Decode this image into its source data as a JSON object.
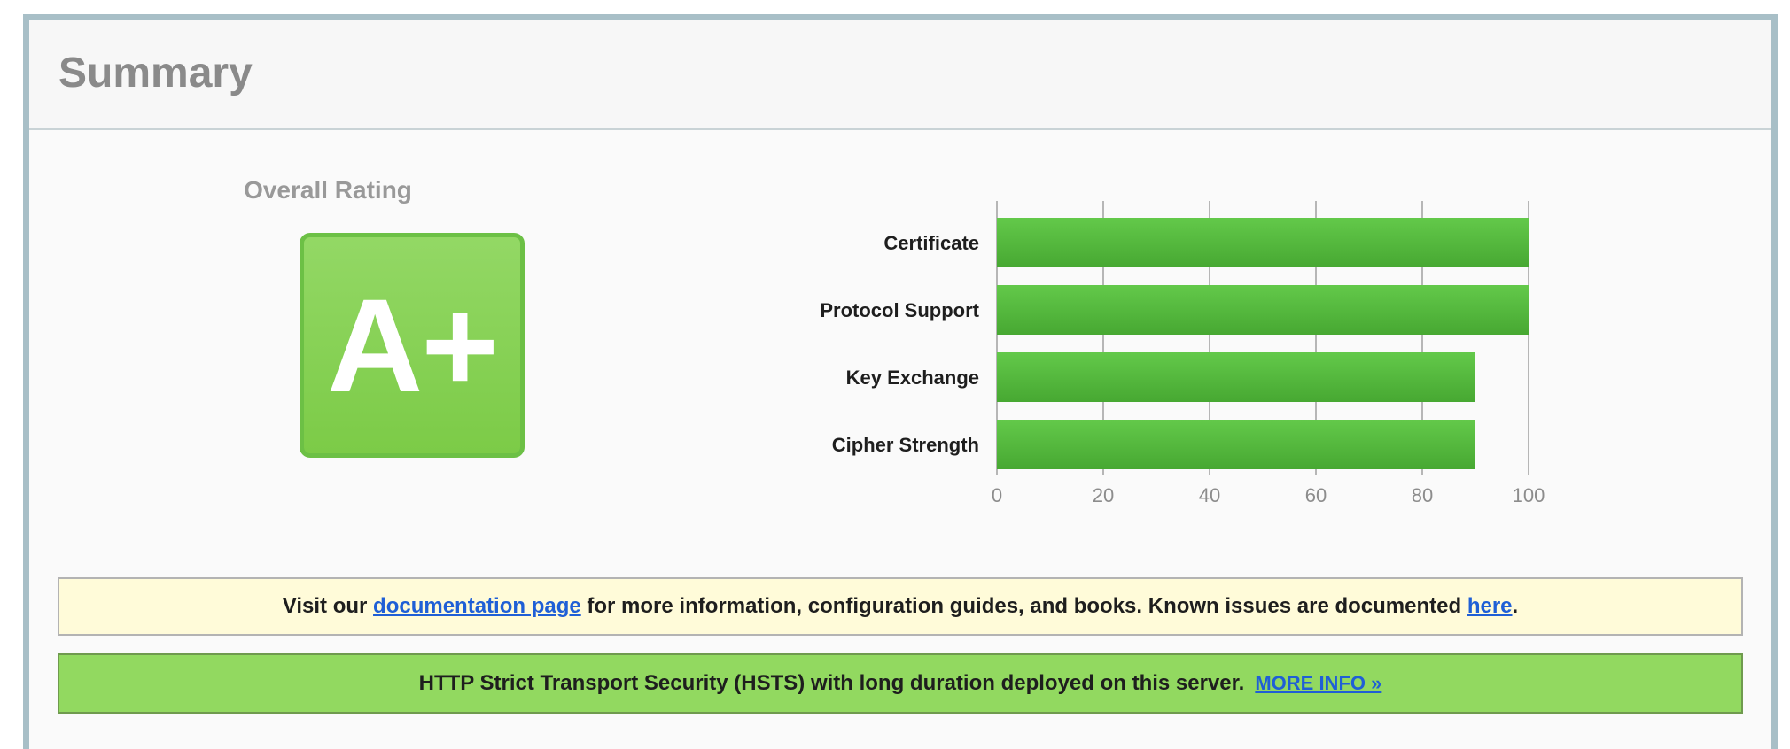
{
  "summary": {
    "title": "Summary"
  },
  "rating": {
    "label": "Overall Rating",
    "grade": "A+",
    "colors": {
      "grade_fill": "#7ccb47",
      "grade_border": "#6cc045"
    }
  },
  "chart_data": {
    "type": "bar",
    "orientation": "horizontal",
    "categories": [
      "Certificate",
      "Protocol Support",
      "Key Exchange",
      "Cipher Strength"
    ],
    "values": [
      100,
      100,
      90,
      90
    ],
    "x_ticks": [
      "0",
      "20",
      "40",
      "60",
      "80",
      "100"
    ],
    "xlim": [
      0,
      100
    ],
    "grid": true,
    "bar_color": "#52b93b"
  },
  "notice": {
    "prefix": "Visit our ",
    "doc_link": "documentation page",
    "middle": " for more information, configuration guides, and books. Known issues are documented ",
    "here_link": "here",
    "suffix": "."
  },
  "hsts": {
    "text": "HTTP Strict Transport Security (HSTS) with long duration deployed on this server.",
    "more_info": "MORE INFO »"
  }
}
